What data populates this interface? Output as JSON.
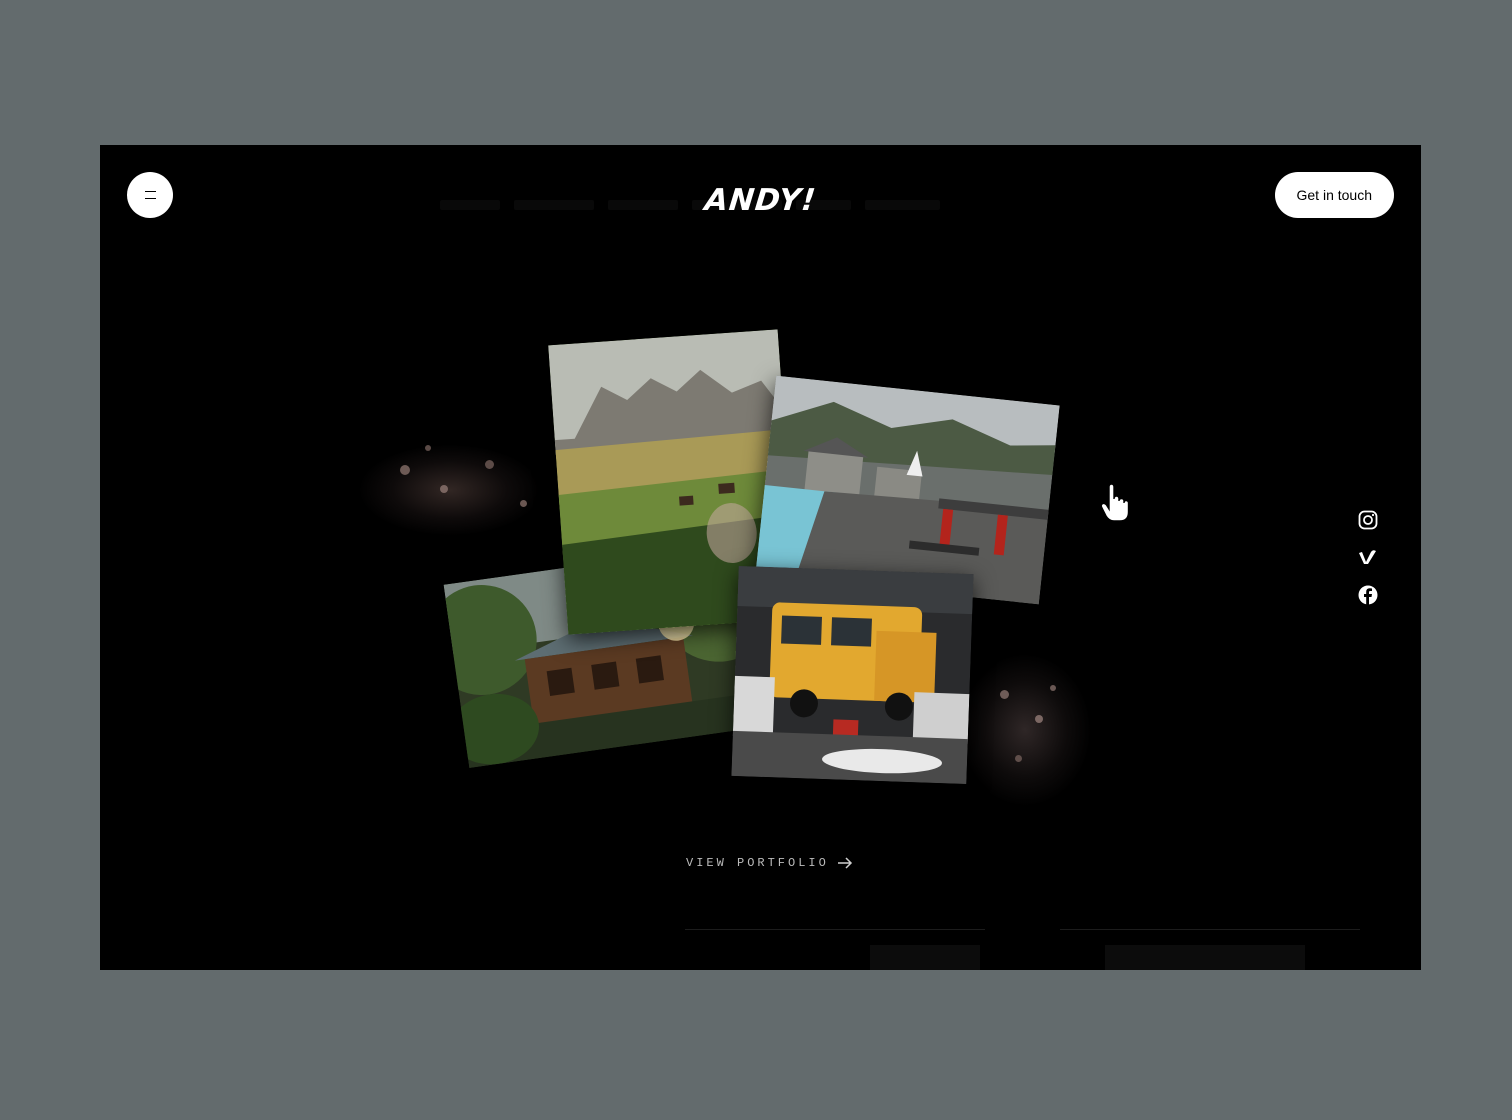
{
  "header": {
    "menu_label": "=",
    "logo_text": "ANDY!",
    "cta_label": "Get in touch"
  },
  "gallery": {
    "photos": [
      {
        "name": "mountain-meadow-photo",
        "subject": "mountain meadow"
      },
      {
        "name": "villa-pool-photo",
        "subject": "villa with pool"
      },
      {
        "name": "forest-cabin-photo",
        "subject": "forest cabin"
      },
      {
        "name": "yellow-bus-photo",
        "subject": "yellow bus"
      }
    ]
  },
  "social": {
    "items": [
      {
        "name": "instagram-icon"
      },
      {
        "name": "vimeo-icon"
      },
      {
        "name": "facebook-icon"
      }
    ]
  },
  "portfolio": {
    "link_label": "VIEW PORTFOLIO",
    "arrow_icon": "arrow-right-icon"
  },
  "colors": {
    "page_background": "#636b6d",
    "window_background": "#000000",
    "button_background": "#ffffff"
  }
}
